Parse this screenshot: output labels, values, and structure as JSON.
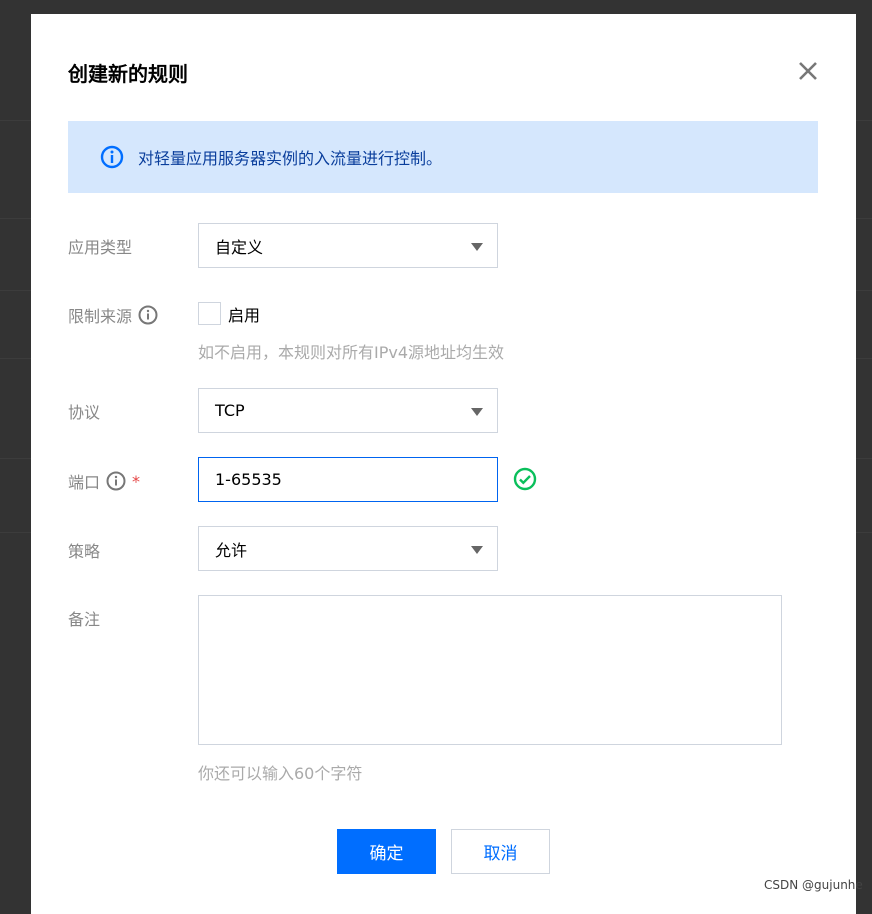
{
  "dialog": {
    "title": "创建新的规则",
    "close_icon": "close-icon"
  },
  "alert": {
    "icon": "info-circle-icon",
    "text": "对轻量应用服务器实例的入流量进行控制。",
    "bg": "#d5e7fd"
  },
  "form": {
    "app_type": {
      "label": "应用类型",
      "value": "自定义"
    },
    "source": {
      "label": "限制来源",
      "checkbox_label": "启用",
      "checked": false,
      "hint": "如不启用，本规则对所有IPv4源地址均生效"
    },
    "protocol": {
      "label": "协议",
      "value": "TCP"
    },
    "port": {
      "label": "端口",
      "required": "*",
      "value": "1-65535",
      "valid": true
    },
    "policy": {
      "label": "策略",
      "value": "允许"
    },
    "remark": {
      "label": "备注",
      "value": "",
      "hint": "你还可以输入60个字符"
    }
  },
  "buttons": {
    "ok": "确定",
    "cancel": "取消"
  },
  "colors": {
    "primary": "#006eff",
    "success": "#0abf5b",
    "danger": "#e54545"
  },
  "watermark": "CSDN @gujunhe"
}
